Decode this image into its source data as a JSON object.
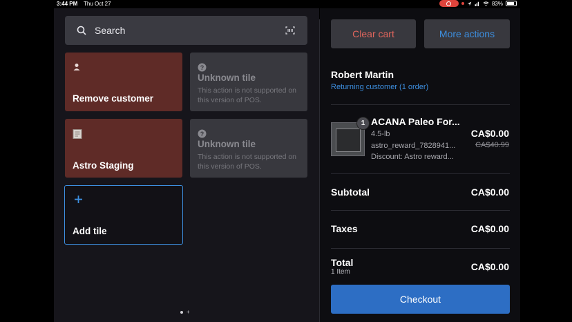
{
  "status_bar": {
    "time": "3:44 PM",
    "date": "Thu Oct 27",
    "battery": "83%",
    "icons": [
      "record-icon",
      "location-icon",
      "signal-icon",
      "wifi-icon",
      "battery-icon"
    ]
  },
  "search": {
    "label": "Search",
    "icon": "search-icon",
    "barcode_icon": "barcode-icon"
  },
  "tiles": [
    {
      "title": "Remove customer",
      "icon": "person-icon",
      "color": "#5f2b27"
    },
    {
      "title": "Unknown tile",
      "desc": "This action is not supported on this version of POS.",
      "icon": "question-icon"
    },
    {
      "title": "Astro Staging",
      "icon": "document-icon",
      "color": "#5f2b27"
    },
    {
      "title": "Unknown tile",
      "desc": "This action is not supported on this version of POS.",
      "icon": "question-icon"
    },
    {
      "title": "Add tile",
      "icon": "plus-icon",
      "accent": "#3d8fe0"
    }
  ],
  "pager": {
    "pages": 1,
    "has_add": true
  },
  "cart": {
    "clear_label": "Clear cart",
    "clear_color": "#e2665d",
    "more_label": "More actions",
    "more_color": "#3d8fe0",
    "customer": {
      "name": "Robert Martin",
      "subtitle": "Returning customer (1 order)"
    },
    "line_item": {
      "quantity": "1",
      "name": "ACANA Paleo For...",
      "variant": "4.5-lb",
      "sku": "astro_reward_7828941...",
      "discount": "Discount: Astro reward...",
      "price": "CA$0.00",
      "original_price": "CA$40.99"
    },
    "subtotal_label": "Subtotal",
    "subtotal_value": "CA$0.00",
    "taxes_label": "Taxes",
    "taxes_value": "CA$0.00",
    "total_label": "Total",
    "total_value": "CA$0.00",
    "total_items": "1 Item",
    "checkout_label": "Checkout",
    "checkout_color": "#2d6ec4"
  }
}
